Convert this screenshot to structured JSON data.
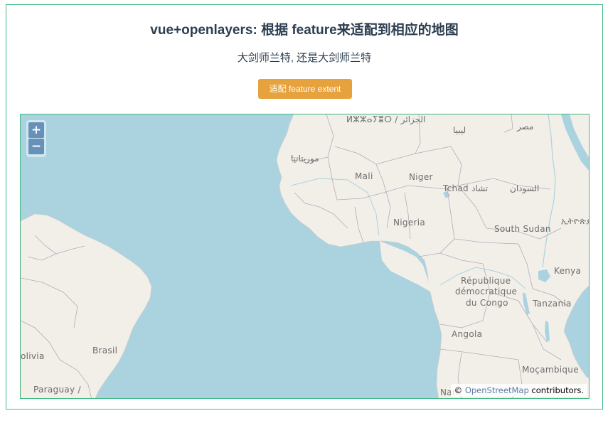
{
  "header": {
    "title": "vue+openlayers: 根据 feature来适配到相应的地图",
    "subtitle": "大剑师兰特, 还是大剑师兰特"
  },
  "toolbar": {
    "fit_label": "适配 feature extent"
  },
  "map": {
    "zoom_in": "+",
    "zoom_out": "−",
    "attribution_prefix": "©",
    "attribution_link": "OpenStreetMap",
    "attribution_suffix": "contributors.",
    "labels": {
      "algeria": "ⵍⵣⵣⴰⵢⴻⵔ / الجزائر",
      "libya": "ليبيا",
      "egypt": "مصر",
      "mauritania": "موريتانيا",
      "mali": "Mali",
      "niger": "Niger",
      "chad": "Tchad تشاد",
      "sudan": "السودان",
      "nigeria": "Nigeria",
      "south_sudan": "South Sudan",
      "ethiopia": "ኢትዮጵያ",
      "drc_1": "République",
      "drc_2": "démocratique",
      "drc_3": "du Congo",
      "kenya": "Kenya",
      "tanzania": "Tanzania",
      "angola": "Angola",
      "brasil": "Brasil",
      "bolivia": "olivia",
      "paraguay": "Paraguay /",
      "mozambique": "Moçambique",
      "namibia": "Nam"
    },
    "colors": {
      "water": "#aad3df",
      "land": "#f2efe9",
      "border": "#b9a8b9",
      "accent_border": "#42b983",
      "button": "#e6a23c"
    }
  }
}
